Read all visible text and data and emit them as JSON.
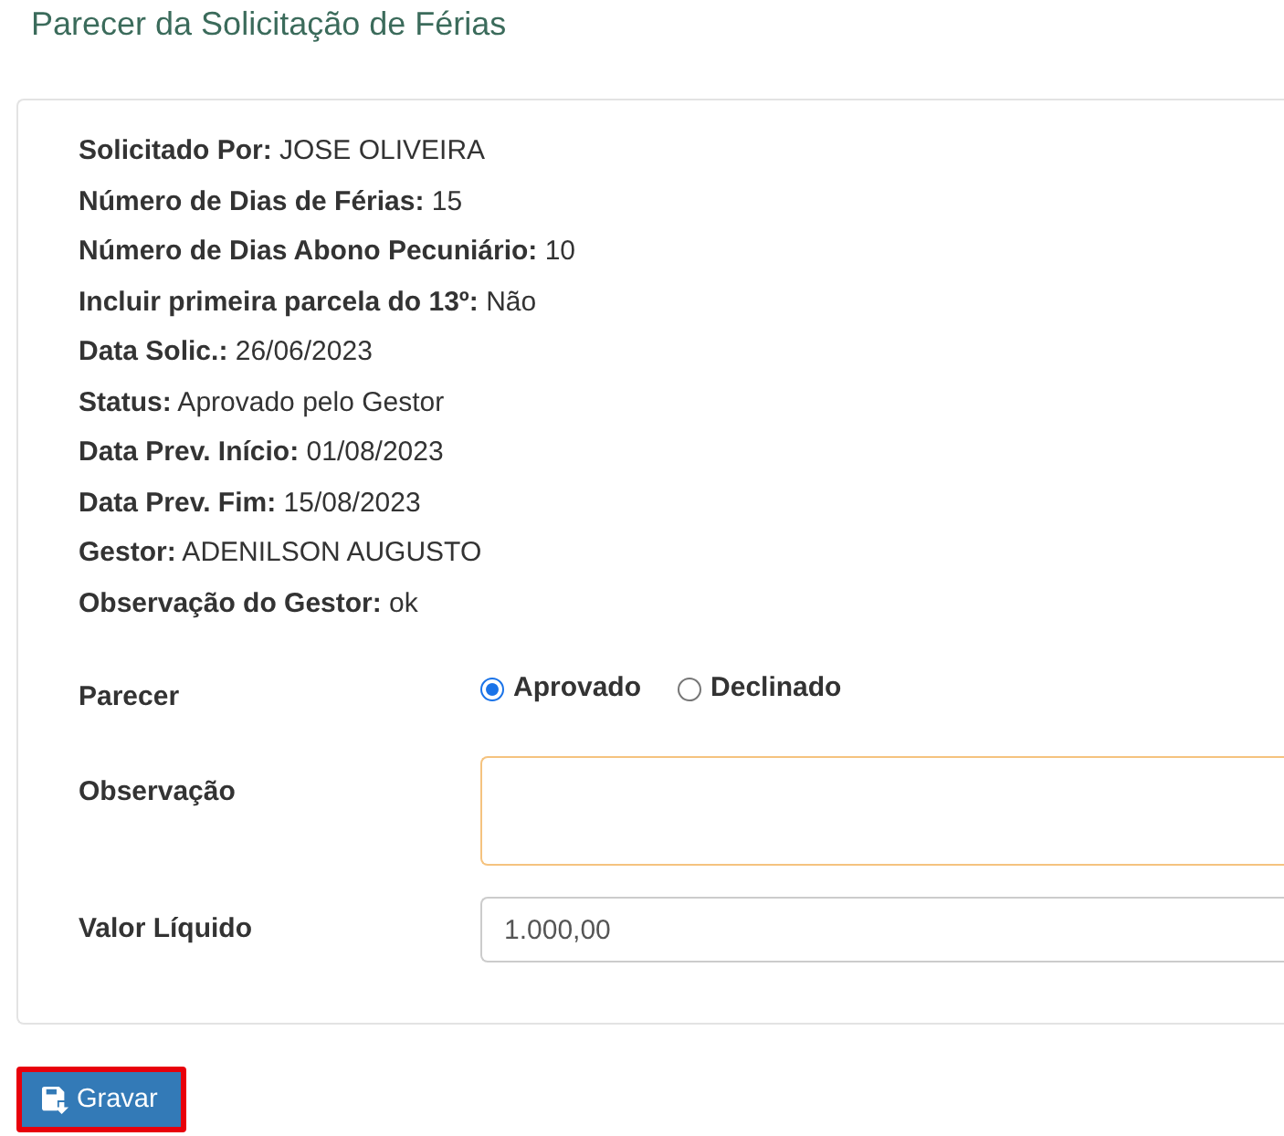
{
  "page_title": "Parecer da Solicitação de Férias",
  "details": [
    "**Solicitado Por:** JOSE OLIVEIRA",
    "**Número de Dias de Férias:** 15",
    "**Número de Dias Abono Pecuniário:** 10",
    "**Incluir primeira parcela do 13º:** Não",
    "**Data Solic.:** 26/06/2023",
    "**Status:** Aprovado pelo Gestor",
    "**Data Prev. Início:** 01/08/2023",
    "**Data Prev. Fim:** 15/08/2023",
    "**Gestor:** ADENILSON AUGUSTO",
    "**Observação do Gestor:** ok"
  ],
  "form_fields": [
    {
      "kind": "radio",
      "label": "Parecer",
      "options": [
        {
          "label": "Aprovado",
          "selected": true
        },
        {
          "label": "Declinado",
          "selected": false
        }
      ]
    },
    {
      "kind": "textarea",
      "label": "Observação"
    },
    {
      "kind": "text",
      "label": "Valor Líquido",
      "value": "1.000,00"
    }
  ],
  "save_button": {
    "label": "Gravar"
  }
}
